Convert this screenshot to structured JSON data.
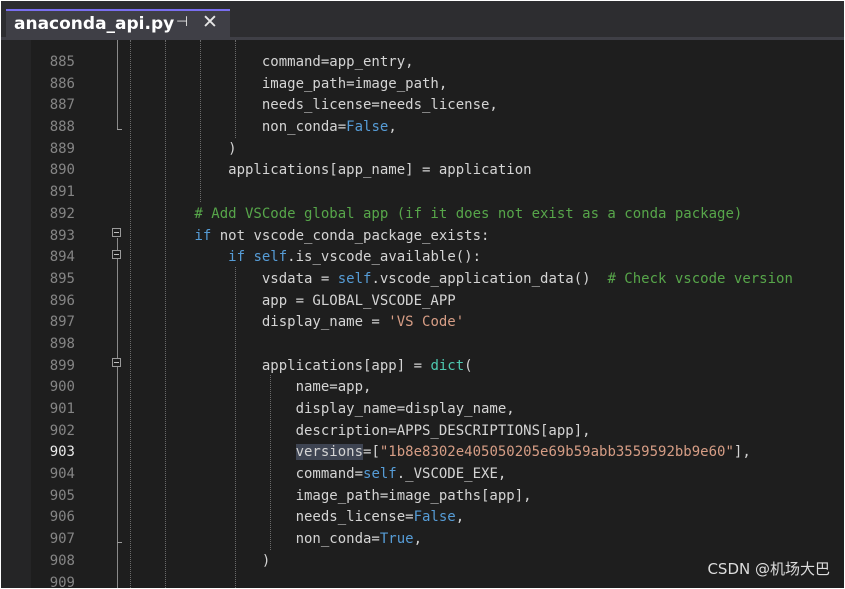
{
  "tab": {
    "title": "anaconda_api.py",
    "pin_icon": "⊣",
    "close_icon": "✕"
  },
  "line_numbers": [
    "885",
    "886",
    "887",
    "888",
    "889",
    "890",
    "891",
    "892",
    "893",
    "894",
    "895",
    "896",
    "897",
    "898",
    "899",
    "900",
    "901",
    "902",
    "903",
    "904",
    "905",
    "906",
    "907",
    "908",
    "909"
  ],
  "current_line": "903",
  "code": [
    [
      {
        "t": "                command=app_entry,",
        "c": ""
      }
    ],
    [
      {
        "t": "                image_path=image_path,",
        "c": ""
      }
    ],
    [
      {
        "t": "                needs_license=needs_license,",
        "c": ""
      }
    ],
    [
      {
        "t": "                non_conda=",
        "c": ""
      },
      {
        "t": "False",
        "c": "c-kw"
      },
      {
        "t": ",",
        "c": ""
      }
    ],
    [
      {
        "t": "            )",
        "c": ""
      }
    ],
    [
      {
        "t": "            applications[app_name] = application",
        "c": ""
      }
    ],
    [
      {
        "t": "",
        "c": ""
      }
    ],
    [
      {
        "t": "        # Add VSCode global app (if it does not exist as a conda package)",
        "c": "c-cmt"
      }
    ],
    [
      {
        "t": "        ",
        "c": ""
      },
      {
        "t": "if",
        "c": "c-kw"
      },
      {
        "t": " not vscode_conda_package_exists:",
        "c": ""
      }
    ],
    [
      {
        "t": "            ",
        "c": ""
      },
      {
        "t": "if",
        "c": "c-kw"
      },
      {
        "t": " ",
        "c": ""
      },
      {
        "t": "self",
        "c": "c-self"
      },
      {
        "t": ".is_vscode_available():",
        "c": ""
      }
    ],
    [
      {
        "t": "                vsdata = ",
        "c": ""
      },
      {
        "t": "self",
        "c": "c-self"
      },
      {
        "t": ".vscode_application_data()  ",
        "c": ""
      },
      {
        "t": "# Check vscode version",
        "c": "c-cmt"
      }
    ],
    [
      {
        "t": "                app = GLOBAL_VSCODE_APP",
        "c": ""
      }
    ],
    [
      {
        "t": "                display_name = ",
        "c": ""
      },
      {
        "t": "'VS Code'",
        "c": "c-str"
      }
    ],
    [
      {
        "t": "",
        "c": ""
      }
    ],
    [
      {
        "t": "                applications[app] = ",
        "c": ""
      },
      {
        "t": "dict",
        "c": "c-bi"
      },
      {
        "t": "(",
        "c": ""
      }
    ],
    [
      {
        "t": "                    name=app,",
        "c": ""
      }
    ],
    [
      {
        "t": "                    display_name=display_name,",
        "c": ""
      }
    ],
    [
      {
        "t": "                    description=APPS_DESCRIPTIONS[app],",
        "c": ""
      }
    ],
    [
      {
        "t": "                    ",
        "c": ""
      },
      {
        "t": "versions",
        "c": "c-hl"
      },
      {
        "t": "=[",
        "c": ""
      },
      {
        "t": "\"1b8e8302e405050205e69b59abb3559592bb9e60\"",
        "c": "c-str"
      },
      {
        "t": "],",
        "c": ""
      }
    ],
    [
      {
        "t": "                    command=",
        "c": ""
      },
      {
        "t": "self",
        "c": "c-self"
      },
      {
        "t": "._VSCODE_EXE,",
        "c": ""
      }
    ],
    [
      {
        "t": "                    image_path=image_paths[app],",
        "c": ""
      }
    ],
    [
      {
        "t": "                    needs_license=",
        "c": ""
      },
      {
        "t": "False",
        "c": "c-kw"
      },
      {
        "t": ",",
        "c": ""
      }
    ],
    [
      {
        "t": "                    non_conda=",
        "c": ""
      },
      {
        "t": "True",
        "c": "c-kw"
      },
      {
        "t": ",",
        "c": ""
      }
    ],
    [
      {
        "t": "                )",
        "c": ""
      }
    ],
    [
      {
        "t": "",
        "c": ""
      }
    ]
  ],
  "watermark": "CSDN @机场大巴",
  "colors": {
    "background": "#1e1e1e",
    "keyword": "#569cd6",
    "builtin": "#4ec9b0",
    "comment": "#57a64a",
    "string": "#d69d85",
    "tab_accent": "#7a6ff0"
  }
}
